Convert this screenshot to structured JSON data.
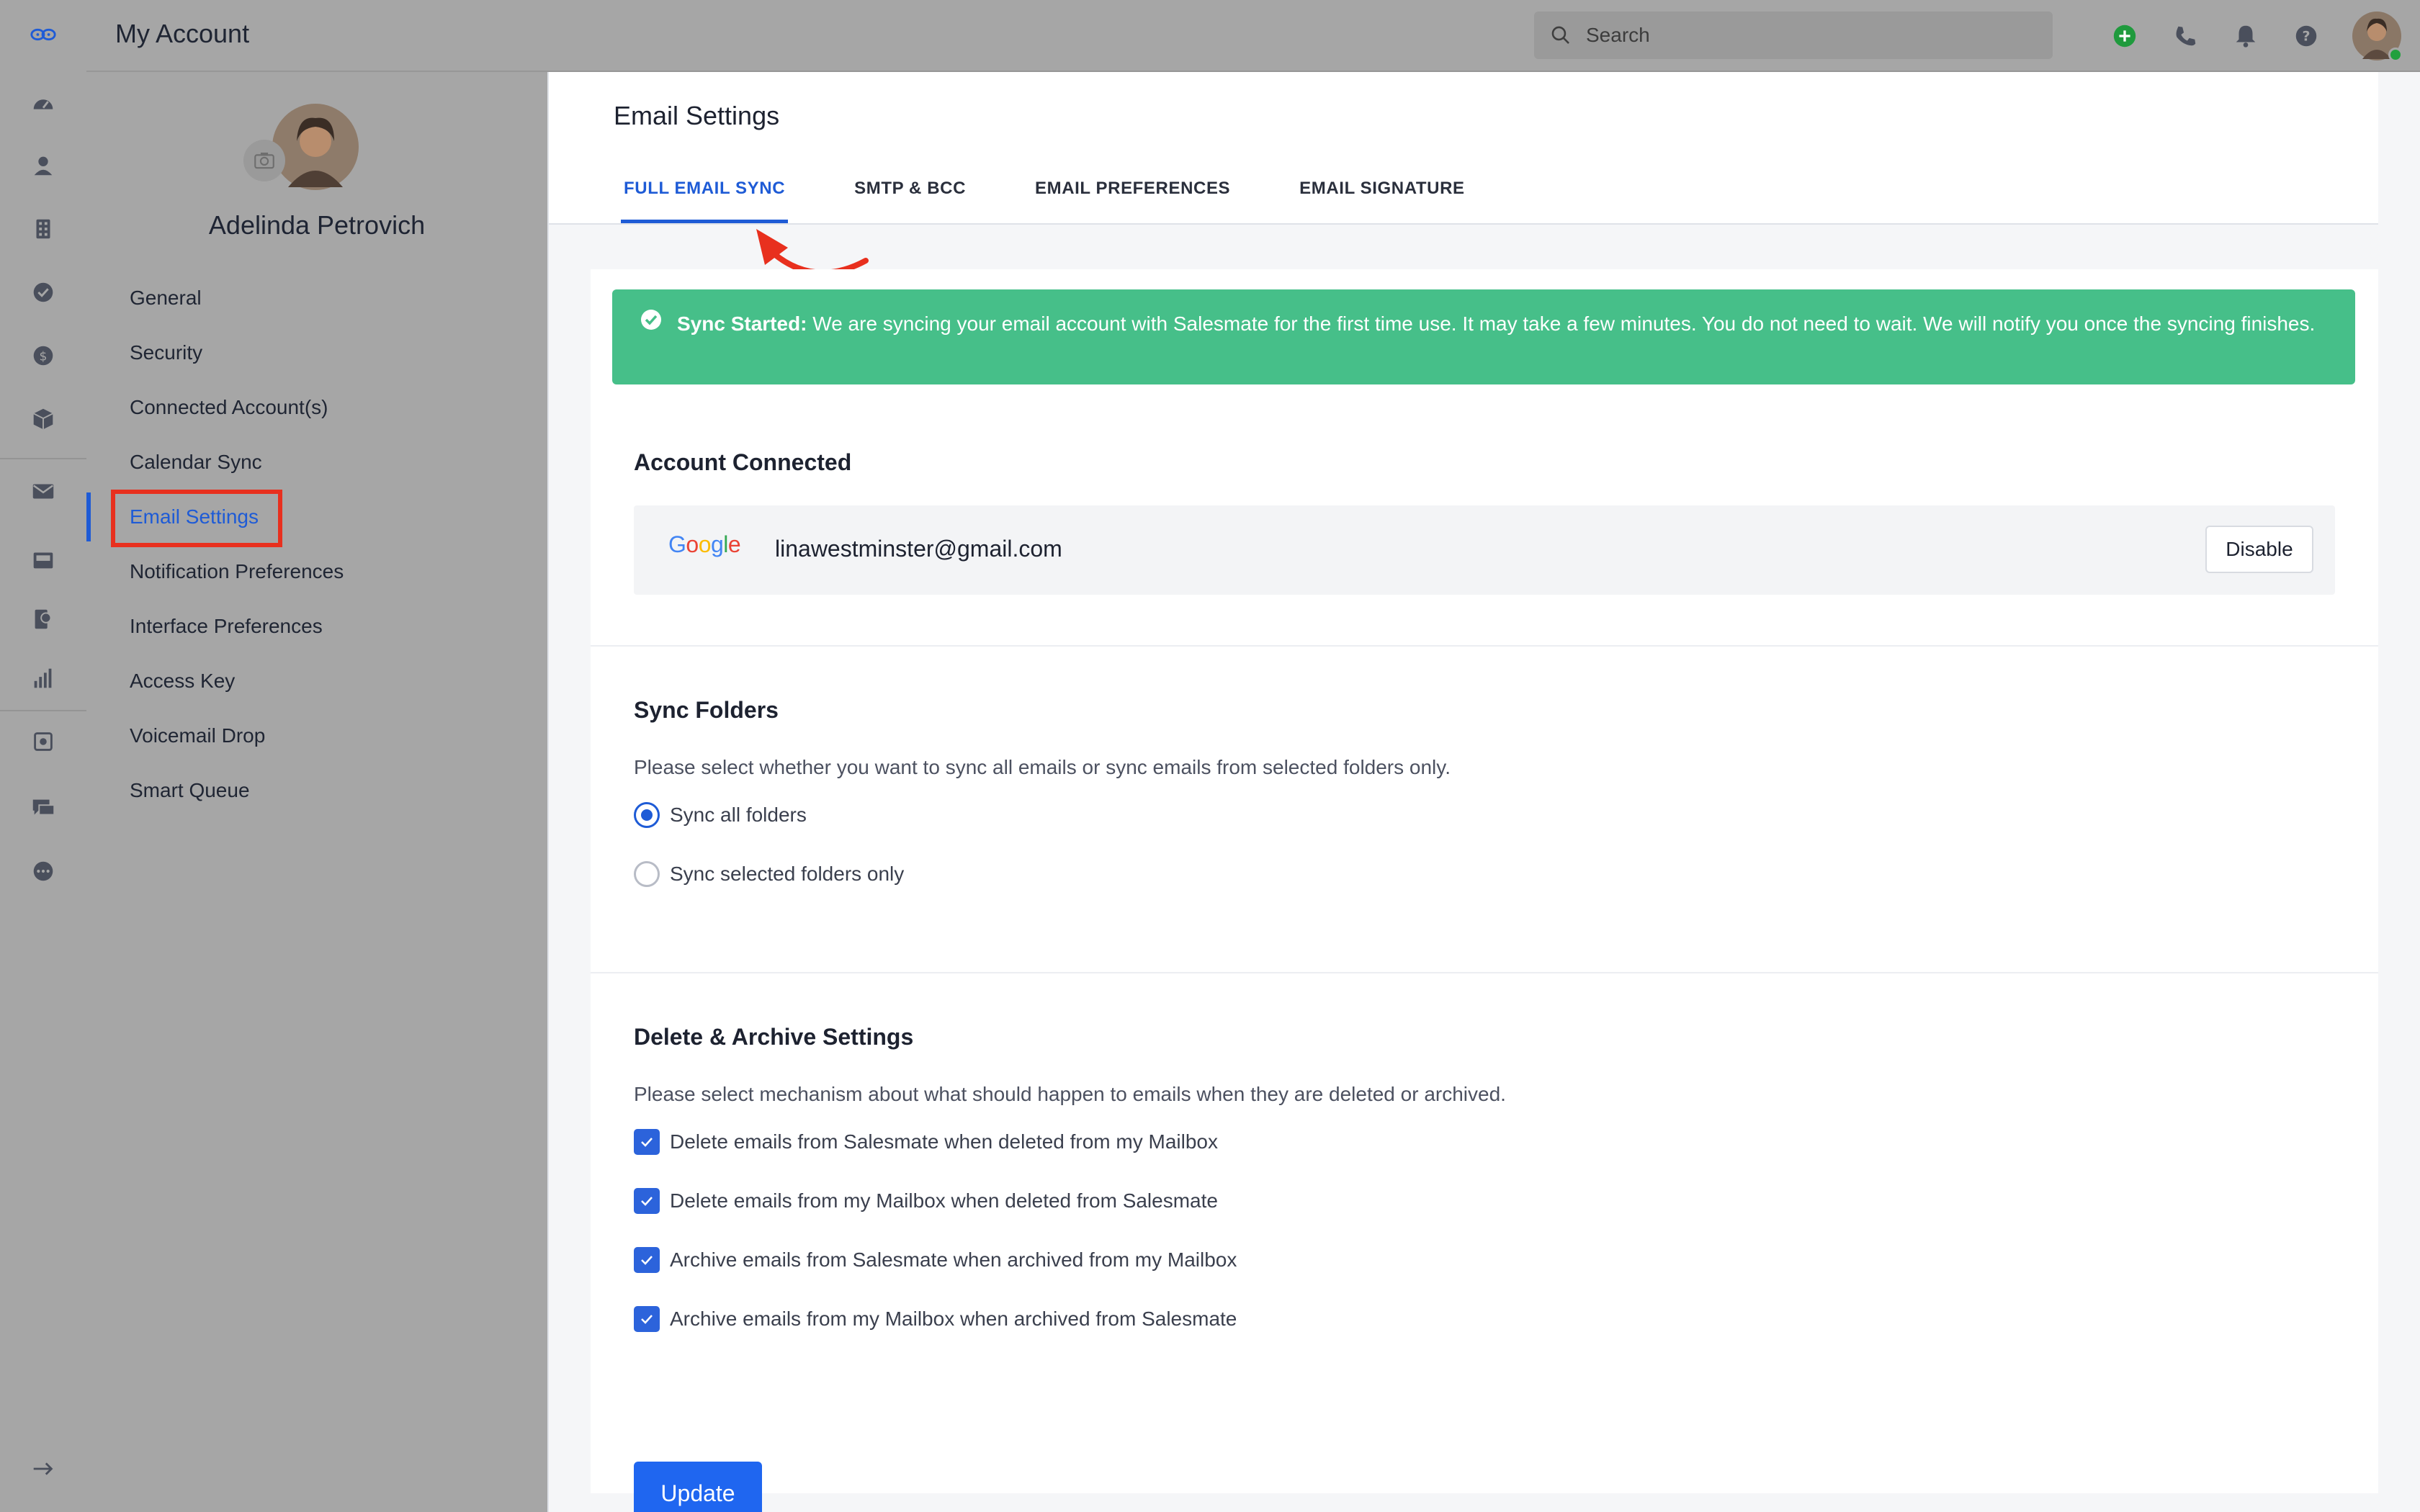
{
  "app": {
    "title": "My Account",
    "search_placeholder": "Search",
    "rail_icons": [
      "logo-icon",
      "dashboard-icon",
      "contacts-icon",
      "companies-icon",
      "tasks-icon",
      "deals-icon",
      "products-icon",
      "email-icon",
      "inbox-icon",
      "campaigns-icon",
      "reports-icon",
      "automation-icon",
      "chat-icon",
      "more-icon",
      "expand-icon"
    ],
    "header_icons": [
      "add-icon",
      "phone-icon",
      "bell-icon",
      "help-icon"
    ]
  },
  "profile": {
    "name": "Adelinda Petrovich"
  },
  "sidebar": {
    "items": [
      {
        "label": "General"
      },
      {
        "label": "Security"
      },
      {
        "label": "Connected Account(s)"
      },
      {
        "label": "Calendar Sync"
      },
      {
        "label": "Email Settings",
        "active": true
      },
      {
        "label": "Notification Preferences"
      },
      {
        "label": "Interface Preferences"
      },
      {
        "label": "Access Key"
      },
      {
        "label": "Voicemail Drop"
      },
      {
        "label": "Smart Queue"
      }
    ]
  },
  "main": {
    "title": "Email Settings",
    "tabs": [
      {
        "label": "FULL EMAIL SYNC",
        "active": true
      },
      {
        "label": "SMTP & BCC"
      },
      {
        "label": "EMAIL PREFERENCES"
      },
      {
        "label": "EMAIL SIGNATURE"
      }
    ],
    "alert": {
      "bold": "Sync Started:",
      "text": " We are syncing your email account with Salesmate for the first time use. It may take a few minutes. You do not need to wait. We will notify you once the syncing finishes."
    },
    "account": {
      "title": "Account Connected",
      "provider": "Google",
      "email": "linawestminster@gmail.com",
      "disable_label": "Disable"
    },
    "sync_folders": {
      "title": "Sync Folders",
      "description": "Please select whether you want to sync all emails or sync emails from selected folders only.",
      "options": [
        {
          "label": "Sync all folders",
          "selected": true
        },
        {
          "label": "Sync selected folders only",
          "selected": false
        }
      ]
    },
    "delete_archive": {
      "title": "Delete & Archive Settings",
      "description": "Please select mechanism about what should happen to emails when they are deleted or archived.",
      "options": [
        {
          "label": "Delete emails from Salesmate when deleted from my Mailbox",
          "checked": true
        },
        {
          "label": "Delete emails from my Mailbox when deleted from Salesmate",
          "checked": true
        },
        {
          "label": "Archive emails from Salesmate when archived from my Mailbox",
          "checked": true
        },
        {
          "label": "Archive emails from my Mailbox when archived from Salesmate",
          "checked": true
        }
      ]
    },
    "update_label": "Update"
  },
  "colors": {
    "accent": "#1e5bd6",
    "success": "#46bf89",
    "annotation": "#e8301e",
    "overlay_gray": "#a6a6a6"
  }
}
